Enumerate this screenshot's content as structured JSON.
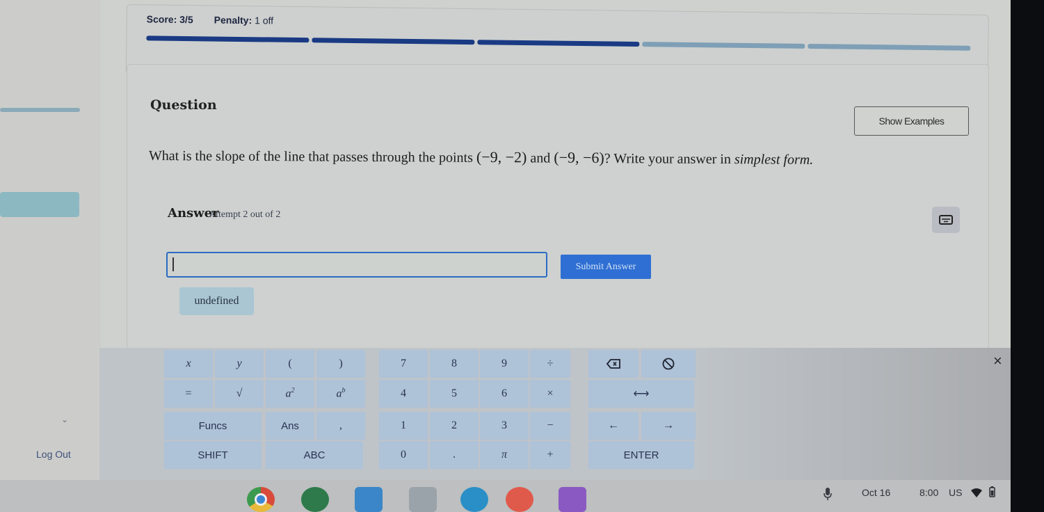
{
  "header": {
    "score_label": "Score: 3/5",
    "penalty_label": "Penalty:",
    "penalty_value": "1 off",
    "progress": {
      "completed": 3,
      "total": 5,
      "filled_color": "#1a3a84",
      "empty_color": "#7e9fb6"
    }
  },
  "question": {
    "title": "Question",
    "show_examples_label": "Show Examples",
    "text_prefix": "What is the slope of the line that passes through the points ",
    "point_1": "(−9, −2)",
    "text_and": " and ",
    "point_2": "(−9, −6)",
    "text_suffix": "? Write your answer in ",
    "text_emphasis": "simplest form.",
    "colors": {
      "accent": "#2f6fd4"
    }
  },
  "answer": {
    "label": "Answer",
    "attempt": "Attempt 2 out of 2",
    "input_value": "",
    "submit_label": "Submit Answer",
    "suggestion_chip": "undefined",
    "keyboard_toggle_icon": "keyboard-icon"
  },
  "sidebar": {
    "logout_label": "Log Out",
    "chevron_icon": "chevron-down-icon"
  },
  "keypad": {
    "rows": [
      [
        "x",
        "y",
        "(",
        ")",
        "7",
        "8",
        "9",
        "÷",
        "backspace-icon",
        "clear-icon"
      ],
      [
        "=",
        "√",
        "a²",
        "aᵇ",
        "4",
        "5",
        "6",
        "×",
        "⟷"
      ],
      [
        "Funcs",
        "Ans",
        ",",
        "1",
        "2",
        "3",
        "−",
        "←",
        "→"
      ],
      [
        "SHIFT",
        "ABC",
        "0",
        ".",
        "π",
        "+",
        "ENTER"
      ]
    ],
    "close_label": "×"
  },
  "taskbar": {
    "apps": [
      "chrome-icon",
      "classroom-icon",
      "app-3-icon",
      "qr-app-icon",
      "slides-app-icon",
      "app-6-icon",
      "app-7-icon"
    ],
    "date": "Oct 16",
    "time": "8:00",
    "locale": "US",
    "mic_icon": "microphone-icon",
    "wifi_icon": "wifi-icon",
    "battery_icon": "battery-icon"
  }
}
